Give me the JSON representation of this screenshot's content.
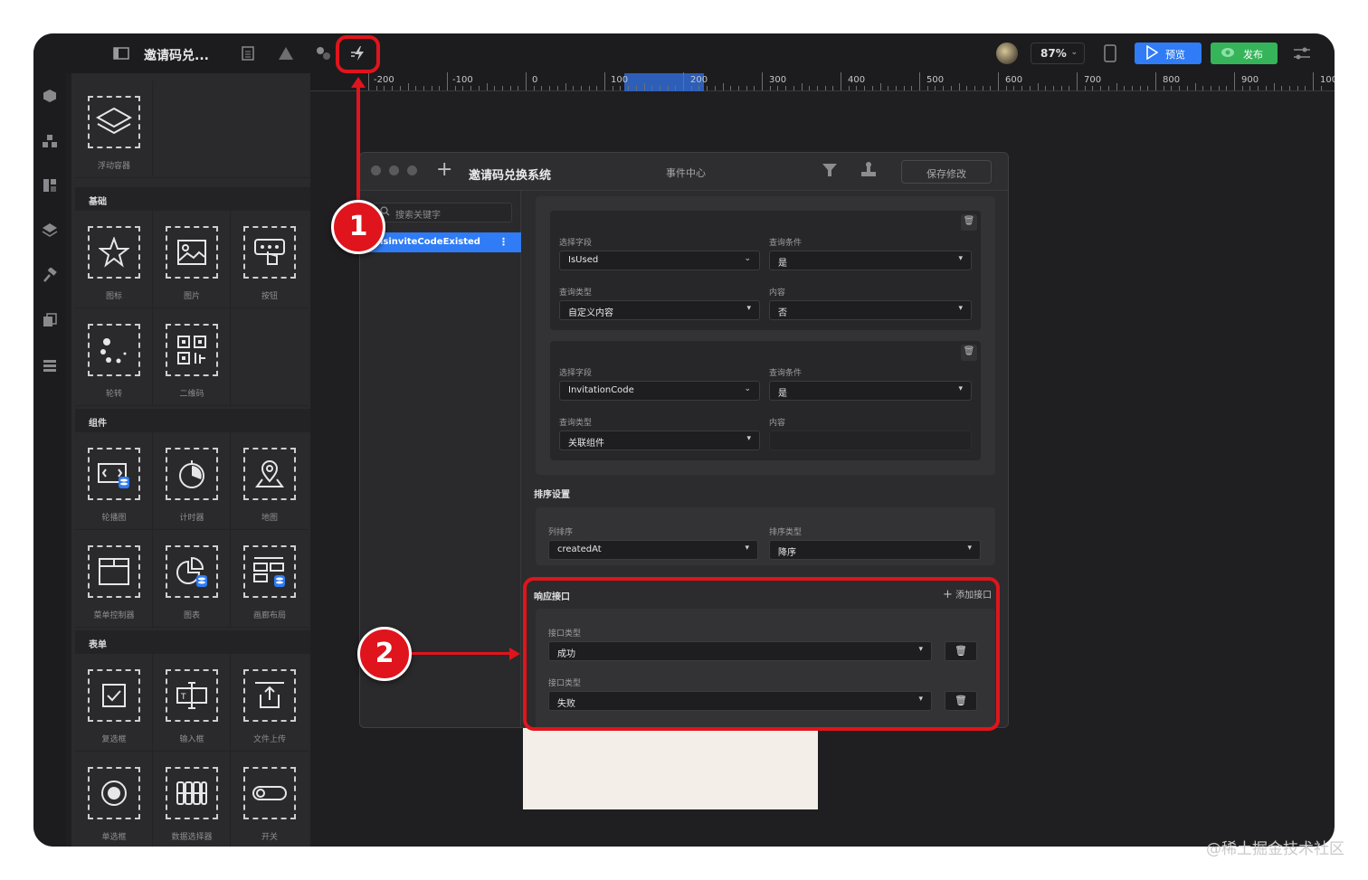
{
  "app": {
    "title": "邀请码兑...",
    "zoom": "87%",
    "preview_label": "预览",
    "publish_label": "发布",
    "brand_colors": {
      "accent": "#2f7cf6",
      "publish": "#35b45a",
      "annotation": "#e0141c"
    }
  },
  "ruler": {
    "labels": [
      "-200",
      "-100",
      "0",
      "100",
      "200",
      "300",
      "400",
      "500",
      "600",
      "700",
      "800",
      "900",
      "1000"
    ]
  },
  "panel": {
    "top_item": {
      "label": "浮动容器",
      "icon": "layers-icon"
    },
    "sections": [
      {
        "title": "基础",
        "items": [
          {
            "label": "图标",
            "icon": "star-icon"
          },
          {
            "label": "图片",
            "icon": "image-icon"
          },
          {
            "label": "按钮",
            "icon": "button-click-icon"
          },
          {
            "label": "轮转",
            "icon": "spinner-icon"
          },
          {
            "label": "二维码",
            "icon": "qrcode-icon"
          }
        ]
      },
      {
        "title": "组件",
        "items": [
          {
            "label": "轮播图",
            "icon": "carousel-icon"
          },
          {
            "label": "计时器",
            "icon": "timer-icon"
          },
          {
            "label": "地图",
            "icon": "map-pin-icon"
          },
          {
            "label": "菜单控制器",
            "icon": "menu-controller-icon"
          },
          {
            "label": "图表",
            "icon": "pie-chart-icon"
          },
          {
            "label": "画廊布局",
            "icon": "gallery-icon"
          }
        ]
      },
      {
        "title": "表单",
        "items": [
          {
            "label": "复选框",
            "icon": "checkbox-icon"
          },
          {
            "label": "输入框",
            "icon": "text-input-icon"
          },
          {
            "label": "文件上传",
            "icon": "upload-icon"
          },
          {
            "label": "单选框",
            "icon": "radio-icon"
          },
          {
            "label": "数据选择器",
            "icon": "data-picker-icon"
          },
          {
            "label": "开关",
            "icon": "toggle-icon"
          }
        ]
      }
    ]
  },
  "dialog": {
    "title": "邀请码兑换系统",
    "center_title": "事件中心",
    "save_label": "保存修改",
    "search_placeholder": "搜索关键字",
    "event_item": "isinviteCodeExisted",
    "more_glyph": "⋮",
    "query_groups": [
      {
        "field_label": "选择字段",
        "field_value": "IsUsed",
        "cond_label": "查询条件",
        "cond_value": "是",
        "type_label": "查询类型",
        "type_value": "自定义内容",
        "content_label": "内容",
        "content_value": "否"
      },
      {
        "field_label": "选择字段",
        "field_value": "InvitationCode",
        "cond_label": "查询条件",
        "cond_value": "是",
        "type_label": "查询类型",
        "type_value": "关联组件",
        "content_label": "内容",
        "content_value": ""
      }
    ],
    "sort": {
      "title": "排序设置",
      "col_label": "列排序",
      "col_value": "createdAt",
      "type_label": "排序类型",
      "type_value": "降序"
    },
    "response": {
      "title": "响应接口",
      "add_label": "添加接口",
      "items": [
        {
          "label": "接口类型",
          "value": "成功"
        },
        {
          "label": "接口类型",
          "value": "失败"
        }
      ]
    }
  },
  "annotations": {
    "badge1": "1",
    "badge2": "2"
  },
  "watermark": "@稀土掘金技术社区"
}
